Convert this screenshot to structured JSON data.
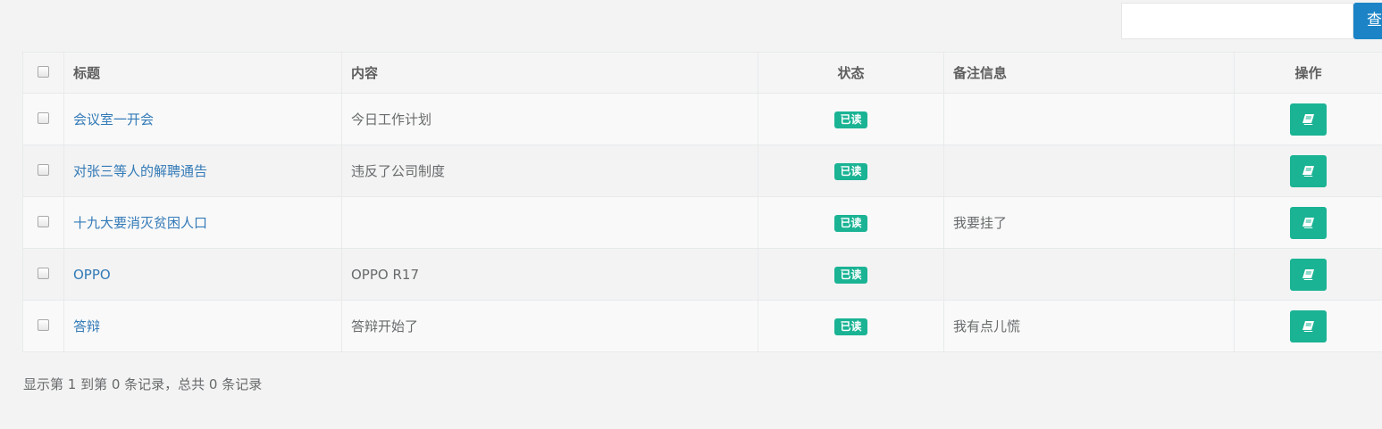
{
  "search": {
    "value": "",
    "button_label": "查询"
  },
  "table": {
    "headers": {
      "title": "标题",
      "content": "内容",
      "status": "状态",
      "remark": "备注信息",
      "action": "操作"
    },
    "rows": [
      {
        "title": "会议室一开会",
        "content": "今日工作计划",
        "status": "已读",
        "remark": ""
      },
      {
        "title": "对张三等人的解聘通告",
        "content": "违反了公司制度",
        "status": "已读",
        "remark": ""
      },
      {
        "title": "十九大要消灭贫困人口",
        "content": "",
        "status": "已读",
        "remark": "我要挂了"
      },
      {
        "title": "OPPO",
        "content": "OPPO R17",
        "status": "已读",
        "remark": ""
      },
      {
        "title": "答辩",
        "content": "答辩开始了",
        "status": "已读",
        "remark": "我有点儿慌"
      }
    ]
  },
  "pagination": {
    "info": "显示第 1 到第 0 条记录，总共 0 条记录"
  },
  "colors": {
    "primary": "#1c84c6",
    "success": "#1ab394",
    "link": "#337ab7"
  },
  "icons": {
    "view_action": "book-icon"
  }
}
